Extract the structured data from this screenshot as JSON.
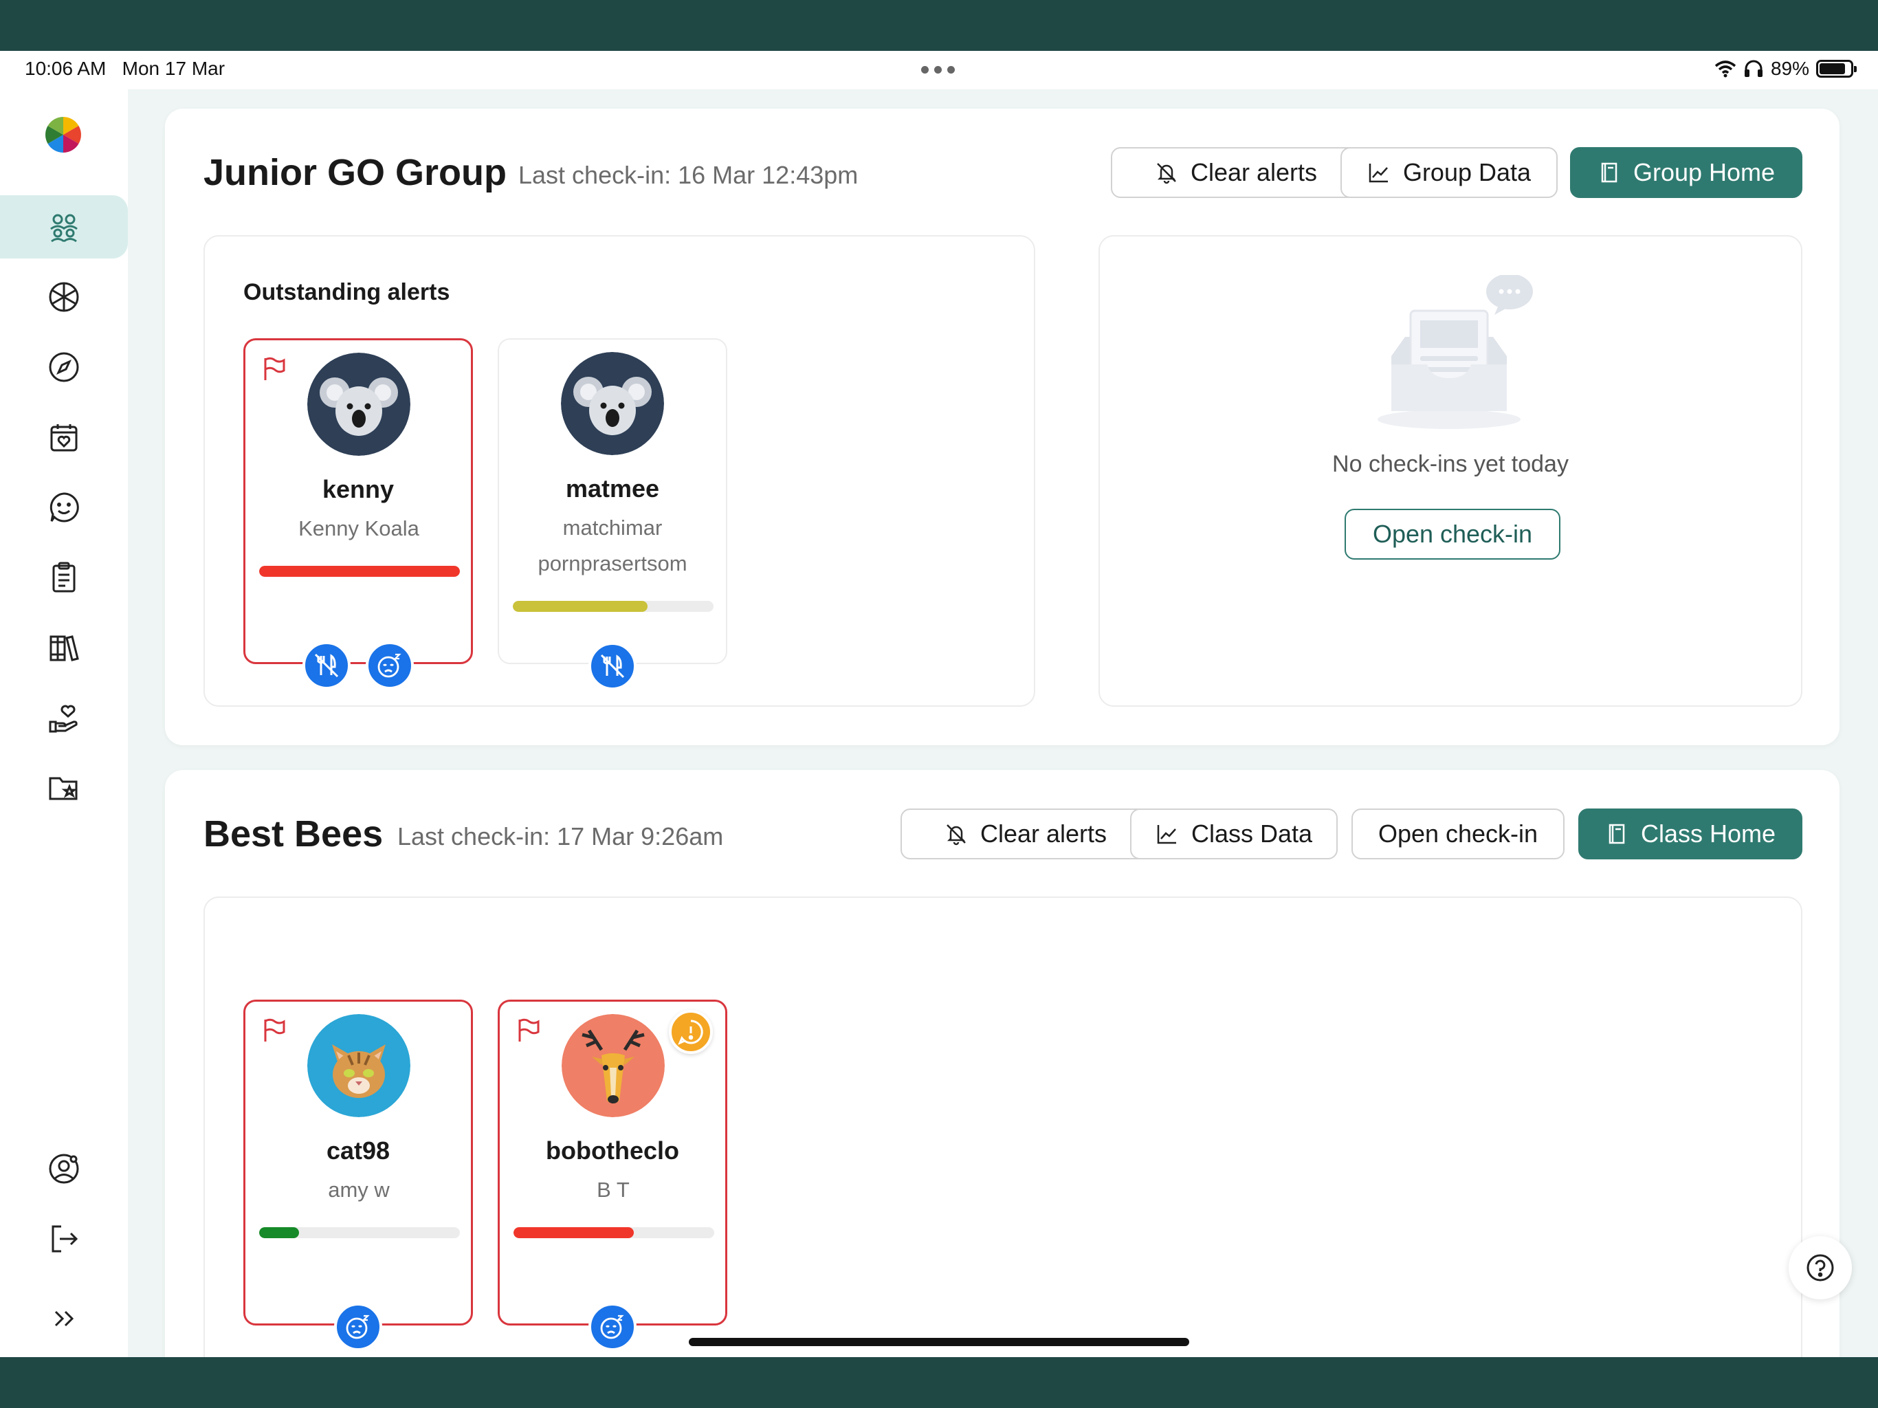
{
  "status_bar": {
    "time": "10:06 AM",
    "date": "Mon 17 Mar",
    "battery": "89%"
  },
  "sidebar": {
    "items": [
      {
        "icon": "groups-icon",
        "active": true
      },
      {
        "icon": "wellbeing-wheel-icon"
      },
      {
        "icon": "compass-icon"
      },
      {
        "icon": "calendar-heart-icon"
      },
      {
        "icon": "chat-face-icon"
      },
      {
        "icon": "clipboard-icon"
      },
      {
        "icon": "books-icon"
      },
      {
        "icon": "helping-hand-icon"
      },
      {
        "icon": "folder-star-icon"
      }
    ],
    "bottom": [
      {
        "icon": "user-settings-icon"
      },
      {
        "icon": "logout-icon"
      },
      {
        "icon": "expand-icon"
      }
    ]
  },
  "groups": [
    {
      "title": "Junior GO Group",
      "last_checkin": "Last check-in: 16 Mar 12:43pm",
      "buttons": {
        "clear": "Clear alerts",
        "data": "Group Data",
        "home": "Group Home"
      },
      "alerts_heading": "Outstanding alerts",
      "students": [
        {
          "username": "kenny",
          "name": "Kenny Koala",
          "progress": 1.0,
          "color": "#f0362a",
          "badges": [
            "no-eating-icon",
            "tired-face-icon"
          ],
          "flagged": true
        },
        {
          "username": "matmee",
          "name": "matchimar pornprasertsom",
          "progress": 0.67,
          "color": "#c9c23a",
          "badges": [
            "no-eating-icon"
          ],
          "flagged": false
        }
      ],
      "empty": {
        "text": "No check-ins yet today",
        "button": "Open check-in"
      }
    },
    {
      "title": "Best Bees",
      "last_checkin": "Last check-in: 17 Mar 9:26am",
      "buttons": {
        "clear": "Clear alerts",
        "data": "Class Data",
        "open": "Open check-in",
        "home": "Class Home"
      },
      "students": [
        {
          "username": "cat98",
          "name": "amy w",
          "progress": 0.2,
          "color": "#168a28",
          "badges": [
            "tired-face-icon"
          ],
          "flagged": true
        },
        {
          "username": "bobotheclo",
          "name": "B T",
          "progress": 0.6,
          "color": "#f0362a",
          "badges": [
            "tired-face-icon"
          ],
          "flagged": true,
          "alert": true
        }
      ]
    }
  ],
  "colors": {
    "brand": "#2f7a70",
    "flag": "#d9363e",
    "badge": "#1a73e8",
    "frame": "#1f4744"
  }
}
